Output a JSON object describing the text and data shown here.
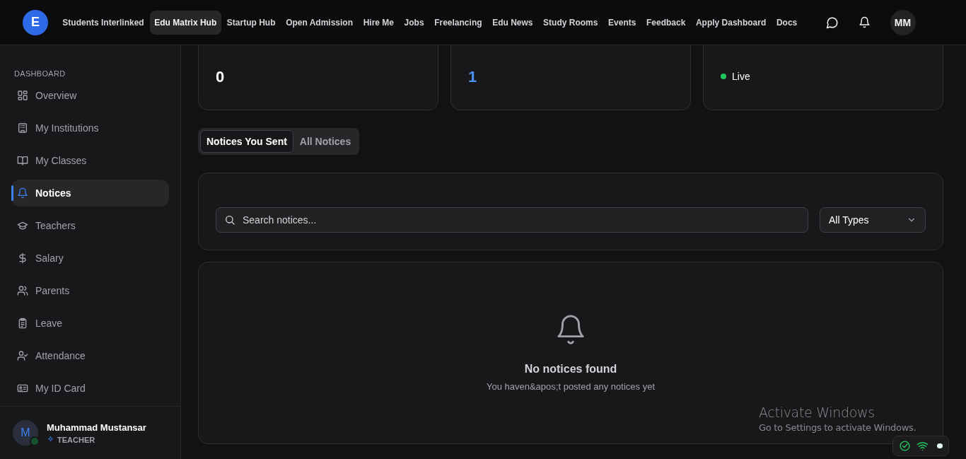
{
  "header": {
    "logo_text": "E",
    "nav": [
      {
        "label": "Students Interlinked",
        "selected": false
      },
      {
        "label": "Edu Matrix Hub",
        "selected": true
      },
      {
        "label": "Startup Hub",
        "selected": false
      },
      {
        "label": "Open Admission",
        "selected": false
      },
      {
        "label": "Hire Me",
        "selected": false
      },
      {
        "label": "Jobs",
        "selected": false
      },
      {
        "label": "Freelancing",
        "selected": false
      },
      {
        "label": "Edu News",
        "selected": false
      },
      {
        "label": "Study Rooms",
        "selected": false
      },
      {
        "label": "Events",
        "selected": false
      },
      {
        "label": "Feedback",
        "selected": false
      },
      {
        "label": "Apply Dashboard",
        "selected": false
      },
      {
        "label": "Docs",
        "selected": false
      }
    ],
    "avatar": "MM"
  },
  "sidebar": {
    "section": "DASHBOARD",
    "items": [
      {
        "label": "Overview",
        "selected": false
      },
      {
        "label": "My Institutions",
        "selected": false
      },
      {
        "label": "My Classes",
        "selected": false
      },
      {
        "label": "Notices",
        "selected": true
      },
      {
        "label": "Teachers",
        "selected": false
      },
      {
        "label": "Salary",
        "selected": false
      },
      {
        "label": "Parents",
        "selected": false
      },
      {
        "label": "Leave",
        "selected": false
      },
      {
        "label": "Attendance",
        "selected": false
      },
      {
        "label": "My ID Card",
        "selected": false
      }
    ],
    "user": {
      "initial": "M",
      "name": "Muhammad Mustansar",
      "role": "TEACHER"
    }
  },
  "stats": [
    {
      "kind": "number",
      "value": "0",
      "color": "#ffffff"
    },
    {
      "kind": "number",
      "value": "1",
      "color": "#4a90f0"
    },
    {
      "kind": "status",
      "value": "Live",
      "color": "#22c55e"
    }
  ],
  "tabs": [
    {
      "label": "Notices You Sent",
      "selected": true
    },
    {
      "label": "All Notices",
      "selected": false
    }
  ],
  "search": {
    "placeholder": "Search notices..."
  },
  "type_filter": {
    "value": "All Types"
  },
  "empty_state": {
    "title": "No notices found",
    "message": "You haven&apos;t posted any notices yet"
  },
  "activation": {
    "title": "Activate Windows",
    "message": "Go to Settings to activate Windows."
  }
}
